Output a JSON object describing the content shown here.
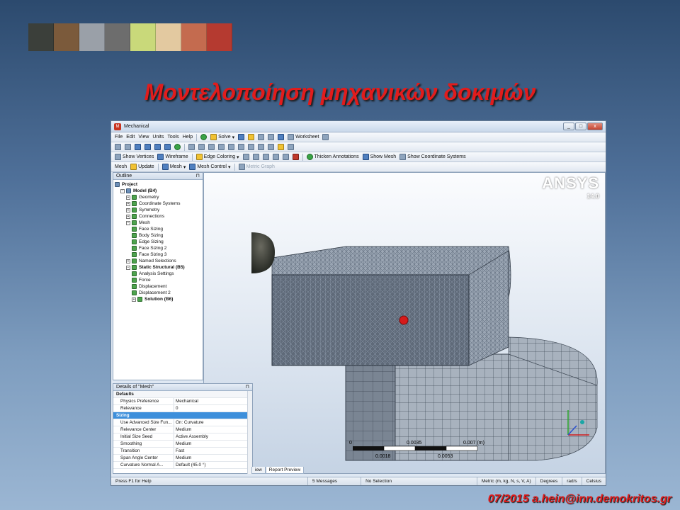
{
  "slide": {
    "title": "Μοντελοποίηση μηχανικών δοκιμών",
    "footer": "07/2015 a.hein@inn.demokritos.gr",
    "logo_tiles": [
      "#3b3f3a",
      "#7b5a3b",
      "#9aa0a8",
      "#6d6d6d",
      "#c9d97a",
      "#e3c9a0",
      "#c46b4f",
      "#b53a30"
    ]
  },
  "app": {
    "title": "Mechanical",
    "window_buttons": [
      "_",
      "□",
      "x"
    ],
    "menu": [
      "File",
      "Edit",
      "View",
      "Units",
      "Tools",
      "Help"
    ],
    "toolbar1": {
      "solve": "Solve",
      "worksheet": "Worksheet"
    },
    "toolbar3": {
      "show_vertices": "Show Vertices",
      "wireframe": "Wireframe",
      "edge_coloring": "Edge Coloring",
      "thicken_annotations": "Thicken Annotations",
      "show_mesh": "Show Mesh",
      "show_coordinate_systems": "Show Coordinate Systems"
    },
    "toolbar4": {
      "mesh": "Mesh",
      "update": "Update",
      "mesh_menu": "Mesh",
      "mesh_control": "Mesh Control",
      "metric_graph": "Metric Graph"
    },
    "outline": {
      "title": "Outline",
      "items": [
        {
          "label": "Project",
          "indent": 0,
          "bold": true
        },
        {
          "label": "Model (B4)",
          "indent": 1,
          "bold": true
        },
        {
          "label": "Geometry",
          "indent": 2
        },
        {
          "label": "Coordinate Systems",
          "indent": 2
        },
        {
          "label": "Symmetry",
          "indent": 2
        },
        {
          "label": "Connections",
          "indent": 2
        },
        {
          "label": "Mesh",
          "indent": 2
        },
        {
          "label": "Face Sizing",
          "indent": 3
        },
        {
          "label": "Body Sizing",
          "indent": 3
        },
        {
          "label": "Edge Sizing",
          "indent": 3
        },
        {
          "label": "Face Sizing 2",
          "indent": 3
        },
        {
          "label": "Face Sizing 3",
          "indent": 3
        },
        {
          "label": "Named Selections",
          "indent": 2
        },
        {
          "label": "Static Structural (B5)",
          "indent": 2,
          "bold": true
        },
        {
          "label": "Analysis Settings",
          "indent": 3
        },
        {
          "label": "Force",
          "indent": 3
        },
        {
          "label": "Displacement",
          "indent": 3
        },
        {
          "label": "Displacement 2",
          "indent": 3
        },
        {
          "label": "Solution (B6)",
          "indent": 3,
          "bold": true
        }
      ]
    },
    "viewport": {
      "brand": "ANSYS",
      "version": "14.0",
      "scale_labels": [
        "0",
        "0.0035",
        "0.007 (m)",
        "0.0018",
        "0.0053"
      ]
    },
    "details": {
      "title": "Details of \"Mesh\"",
      "rows": [
        {
          "type": "section",
          "key": "Defaults"
        },
        {
          "key": "Physics Preference",
          "value": "Mechanical"
        },
        {
          "key": "Relevance",
          "value": "0"
        },
        {
          "type": "section",
          "key": "Sizing",
          "selected": true
        },
        {
          "key": "Use Advanced Size Fun...",
          "value": "On: Curvature"
        },
        {
          "key": "Relevance Center",
          "value": "Medium"
        },
        {
          "key": "Initial Size Seed",
          "value": "Active Assembly"
        },
        {
          "key": "Smoothing",
          "value": "Medium"
        },
        {
          "key": "Transition",
          "value": "Fast"
        },
        {
          "key": "Span Angle Center",
          "value": "Medium"
        },
        {
          "key": "Curvature Normal A...",
          "value": "Default (45.0 °)"
        }
      ]
    },
    "tabs": [
      "iew",
      "Report Preview"
    ],
    "status": {
      "help": "Press F1 for Help",
      "messages": "5 Messages",
      "selection": "No Selection",
      "units": "Metric (m, kg, N, s, V, A)",
      "angle": "Degrees",
      "rate": "rad/s",
      "temp": "Celsius"
    }
  }
}
